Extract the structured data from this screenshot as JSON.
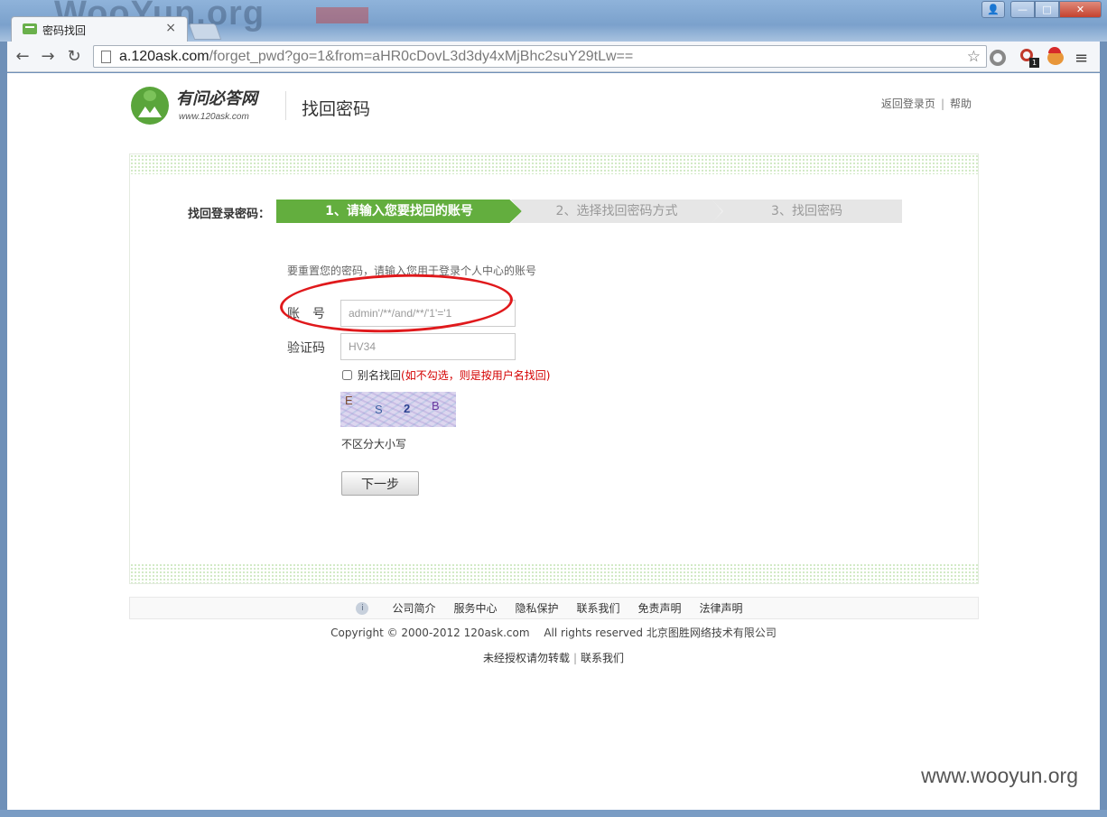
{
  "window": {
    "watermark": "WooYun.org",
    "tab_title": "密码找回",
    "tab_close": "×",
    "controls": {
      "user": "👤",
      "minimize": "—",
      "maximize": "□",
      "close": "✕"
    }
  },
  "toolbar": {
    "back": "←",
    "forward": "→",
    "reload": "↻",
    "url_host": "a.120ask.com",
    "url_path": "/forget_pwd?go=1&from=aHR0cDovL3d3dy4xMjBhc2suY29tLw==",
    "bookmark_star": "☆",
    "extension_badge": "1",
    "menu": "≡"
  },
  "header": {
    "logo_name": "有问必答网",
    "logo_domain": "www.120ask.com",
    "page_title": "找回密码",
    "links": [
      "返回登录页",
      "帮助"
    ],
    "link_separator": "|"
  },
  "steps": {
    "label": "找回登录密码：",
    "items": [
      "1、请输入您要找回的账号",
      "2、选择找回密码方式",
      "3、找回密码"
    ],
    "active_index": 0
  },
  "form": {
    "hint": "要重置您的密码，请输入您用于登录个人中心的账号",
    "account_label": "账　号",
    "account_value": "admin'/**/and/**/'1'='1",
    "captcha_label": "验证码",
    "captcha_value": "HV34",
    "alias_label": "别名找回",
    "alias_note": "(如不勾选，则是按用户名找回)",
    "alias_checked": false,
    "captcha_chars": [
      "E",
      "S",
      "2",
      "B"
    ],
    "case_note": "不区分大小写",
    "next_button": "下一步"
  },
  "footer": {
    "info_icon": "i",
    "links": [
      "公司简介",
      "服务中心",
      "隐私保护",
      "联系我们",
      "免责声明",
      "法律声明"
    ],
    "copyright": "Copyright © 2000-2012 120ask.com　 All rights reserved 北京图胜网络技术有限公司",
    "note_left": "未经授权请勿转载",
    "note_sep": "|",
    "note_right": "联系我们"
  },
  "site_watermark": "www.wooyun.org",
  "colors": {
    "accent_green": "#63ae3e",
    "step_inactive": "#e6e6e6",
    "warning_red": "#d40000",
    "annotation_red": "#e0191c"
  }
}
